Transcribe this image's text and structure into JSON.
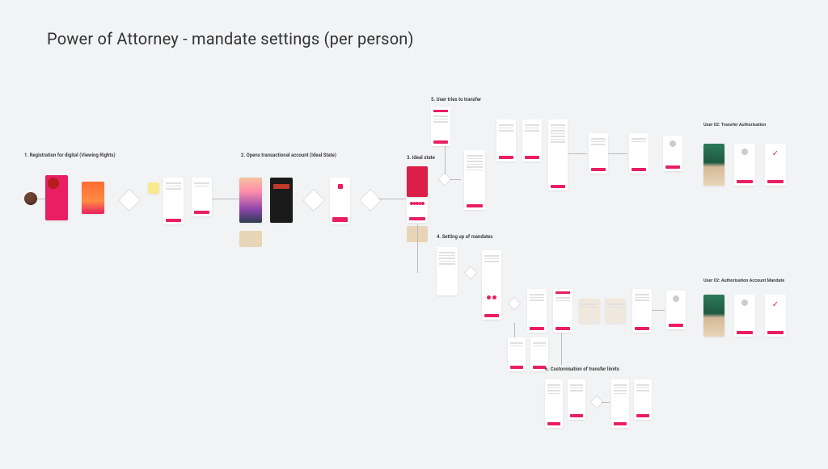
{
  "page_title": "Power of Attorney - mandate settings (per person)",
  "accent_color": "#e91e63",
  "sections": {
    "s1": {
      "label": "1. Registration for digital (Viewing Rights)"
    },
    "s2": {
      "label": "2. Opens transactional account (Ideal State)"
    },
    "s3": {
      "label": "3. Ideal state"
    },
    "s4": {
      "label": "4. Setting up of mandates"
    },
    "s5": {
      "label": "5. User tries to transfer"
    },
    "s6": {
      "label": "6. Customisation of transfer limits"
    }
  },
  "user_flows": {
    "u1": {
      "label": "User 02: Transfer Authorisation"
    },
    "u2": {
      "label": "User 02: Authorisation Account Mandate"
    }
  }
}
